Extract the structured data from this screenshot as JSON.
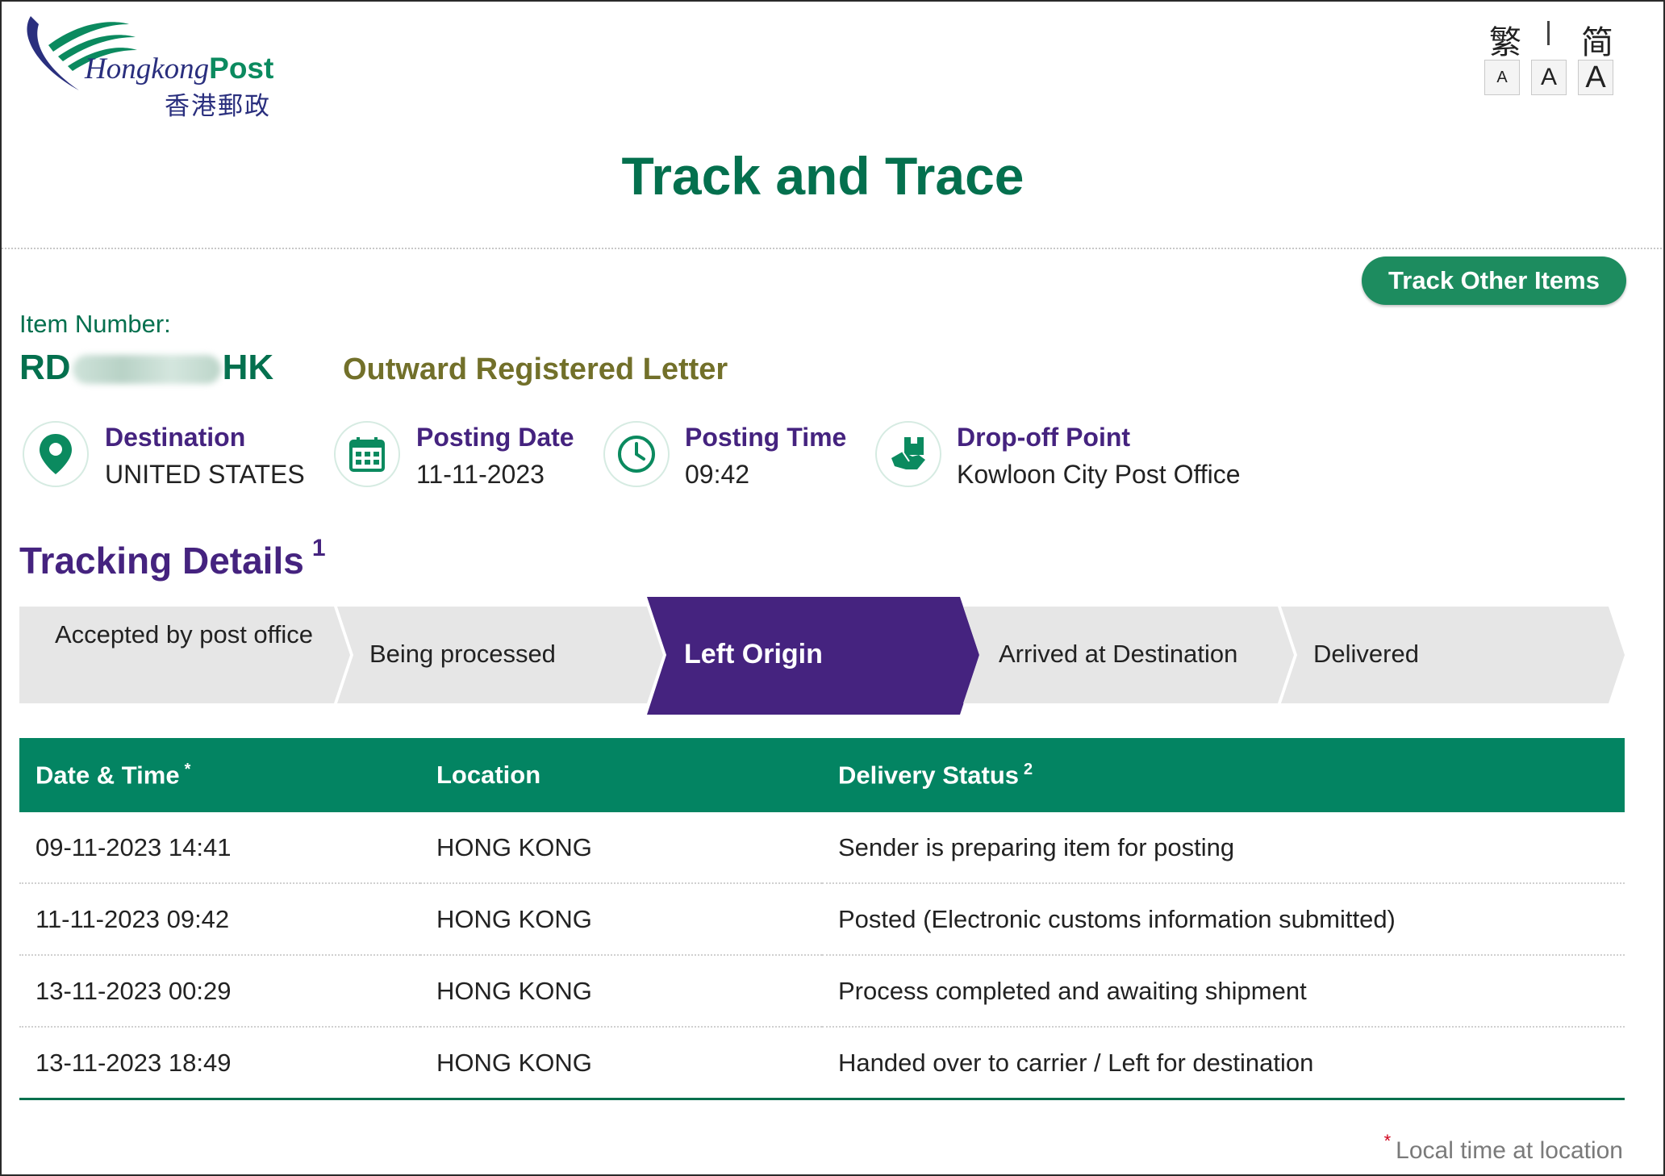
{
  "logo": {
    "name_en_part1": "Hongkong",
    "name_en_part2": "Post",
    "name_zh": "香港郵政"
  },
  "language": {
    "traditional": "繁",
    "simplified": "简"
  },
  "font_size_buttons": [
    "A",
    "A",
    "A"
  ],
  "page_title": "Track and Trace",
  "track_other_label": "Track Other Items",
  "item": {
    "label": "Item Number:",
    "number_prefix": "RD",
    "number_suffix": "HK",
    "type": "Outward Registered Letter"
  },
  "info": [
    {
      "icon": "location-pin-icon",
      "label": "Destination",
      "value": "UNITED STATES"
    },
    {
      "icon": "calendar-icon",
      "label": "Posting Date",
      "value": "11-11-2023"
    },
    {
      "icon": "clock-icon",
      "label": "Posting Time",
      "value": "09:42"
    },
    {
      "icon": "handover-box-icon",
      "label": "Drop-off Point",
      "value": "Kowloon City Post Office"
    }
  ],
  "tracking_details": {
    "title": "Tracking Details",
    "note": "1"
  },
  "steps": [
    {
      "label": "Accepted by post office",
      "active": false
    },
    {
      "label": "Being processed",
      "active": false
    },
    {
      "label": "Left Origin",
      "active": true
    },
    {
      "label": "Arrived at Destination",
      "active": false
    },
    {
      "label": "Delivered",
      "active": false
    }
  ],
  "table": {
    "headers": {
      "datetime": "Date & Time",
      "datetime_note": "*",
      "location": "Location",
      "status": "Delivery Status",
      "status_note": "2"
    },
    "rows": [
      {
        "datetime": "09-11-2023 14:41",
        "location": "HONG KONG",
        "status": "Sender is preparing item for posting"
      },
      {
        "datetime": "11-11-2023 09:42",
        "location": "HONG KONG",
        "status": "Posted (Electronic customs information submitted)"
      },
      {
        "datetime": "13-11-2023 00:29",
        "location": "HONG KONG",
        "status": "Process completed and awaiting shipment"
      },
      {
        "datetime": "13-11-2023 18:49",
        "location": "HONG KONG",
        "status": "Handed over to carrier / Left for destination"
      }
    ]
  },
  "footnote": {
    "star": "*",
    "text": "Local time at location"
  },
  "colors": {
    "green": "#04704e",
    "purple": "#45237f",
    "olive": "#72702a",
    "header_green": "#038462",
    "step_grey": "#e6e6e6"
  }
}
